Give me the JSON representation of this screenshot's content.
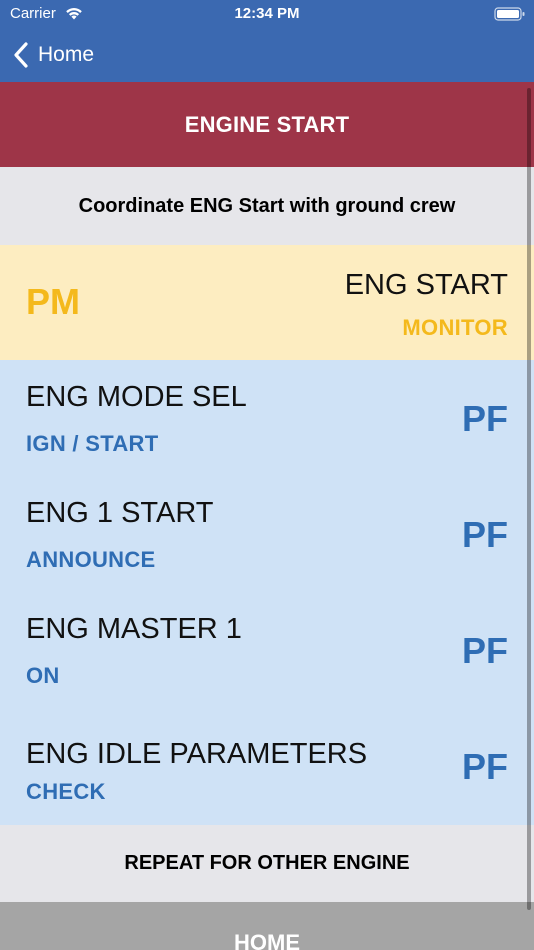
{
  "status_bar": {
    "carrier": "Carrier",
    "time": "12:34 PM",
    "wifi_icon": "wifi-icon",
    "battery_icon": "battery-icon"
  },
  "nav": {
    "back_label": "Home",
    "back_icon": "chevron-left-icon"
  },
  "header": {
    "title": "ENGINE START"
  },
  "info": {
    "text": "Coordinate ENG Start with ground crew"
  },
  "pm_row": {
    "role": "PM",
    "item": "ENG START",
    "action": "MONITOR"
  },
  "pf_rows": [
    {
      "item": "ENG MODE SEL",
      "action": "IGN / START",
      "role": "PF"
    },
    {
      "item": "ENG 1 START",
      "action": "ANNOUNCE",
      "role": "PF"
    },
    {
      "item": "ENG MASTER 1",
      "action": "ON",
      "role": "PF"
    },
    {
      "item": "ENG IDLE PARAMETERS",
      "action": "CHECK",
      "role": "PF"
    }
  ],
  "repeat": {
    "text": "REPEAT FOR OTHER ENGINE"
  },
  "footer": {
    "home_label": "HOME"
  },
  "colors": {
    "nav_blue": "#3b69b1",
    "header_red": "#9e3548",
    "pm_yellow": "#f4b91c",
    "pm_bg": "#fdedc1",
    "pf_blue": "#2f6db4",
    "pf_bg": "#cfe2f6",
    "neutral_bg": "#e6e6ea",
    "home_gray": "#a5a5a5"
  }
}
